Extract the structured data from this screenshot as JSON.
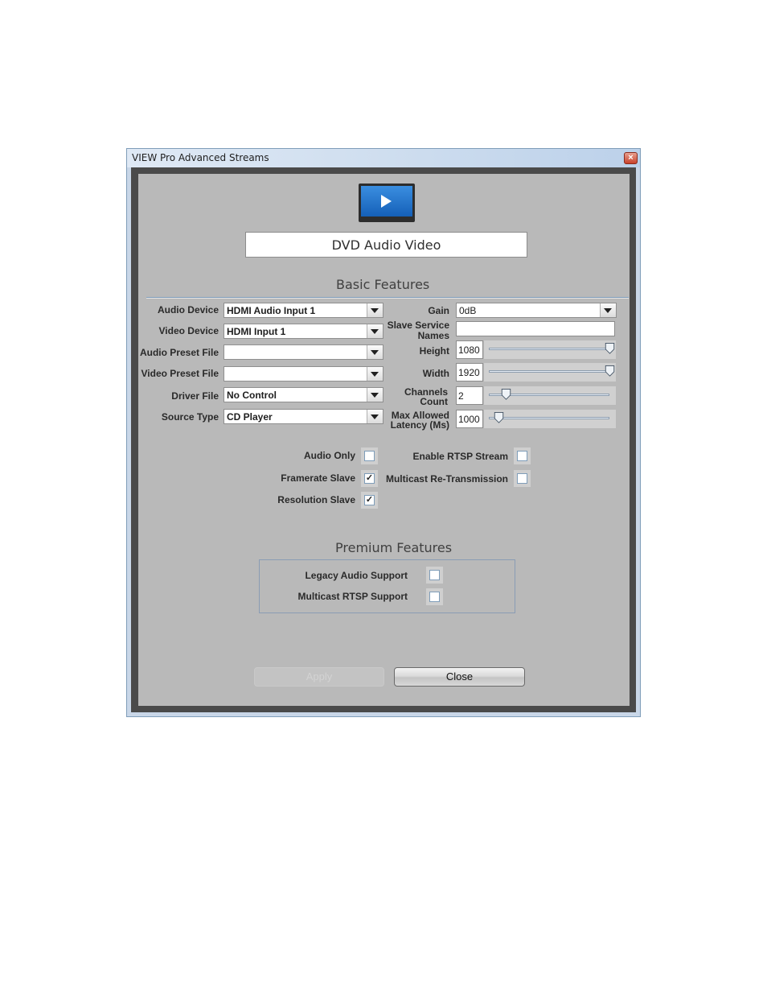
{
  "window": {
    "title": "VIEW Pro Advanced Streams",
    "close_glyph": "×"
  },
  "stream_name": "DVD Audio Video",
  "basic": {
    "title": "Basic Features",
    "audio_device": {
      "label": "Audio Device",
      "value": "HDMI Audio Input 1"
    },
    "video_device": {
      "label": "Video Device",
      "value": "HDMI Input 1"
    },
    "audio_preset": {
      "label": "Audio Preset File",
      "value": ""
    },
    "video_preset": {
      "label": "Video Preset File",
      "value": ""
    },
    "driver_file": {
      "label": "Driver File",
      "value": "No Control"
    },
    "source_type": {
      "label": "Source Type",
      "value": "CD Player"
    },
    "gain": {
      "label": "Gain",
      "value": "0dB"
    },
    "slave_names": {
      "label_line1": "Slave Service",
      "label_line2": "Names",
      "value": ""
    },
    "height": {
      "label": "Height",
      "value": "1080",
      "level": 1.0
    },
    "width": {
      "label": "Width",
      "value": "1920",
      "level": 1.0
    },
    "channels": {
      "label_line1": "Channels",
      "label_line2": "Count",
      "value": "2",
      "level": 0.14
    },
    "latency": {
      "label_line1": "Max Allowed",
      "label_line2": "Latency (Ms)",
      "value": "1000",
      "level": 0.08
    },
    "audio_only": {
      "label": "Audio Only",
      "checked": false
    },
    "framerate_slave": {
      "label": "Framerate Slave",
      "checked": true
    },
    "resolution_slave": {
      "label": "Resolution Slave",
      "checked": true
    },
    "enable_rtsp": {
      "label": "Enable RTSP Stream",
      "checked": false
    },
    "multicast_retx": {
      "label": "Multicast Re-Transmission",
      "checked": false
    }
  },
  "premium": {
    "title": "Premium Features",
    "legacy_audio": {
      "label": "Legacy Audio Support",
      "checked": false
    },
    "multicast_rtsp": {
      "label": "Multicast RTSP Support",
      "checked": false
    }
  },
  "buttons": {
    "apply": "Apply",
    "close": "Close"
  },
  "check_glyph": "✓"
}
